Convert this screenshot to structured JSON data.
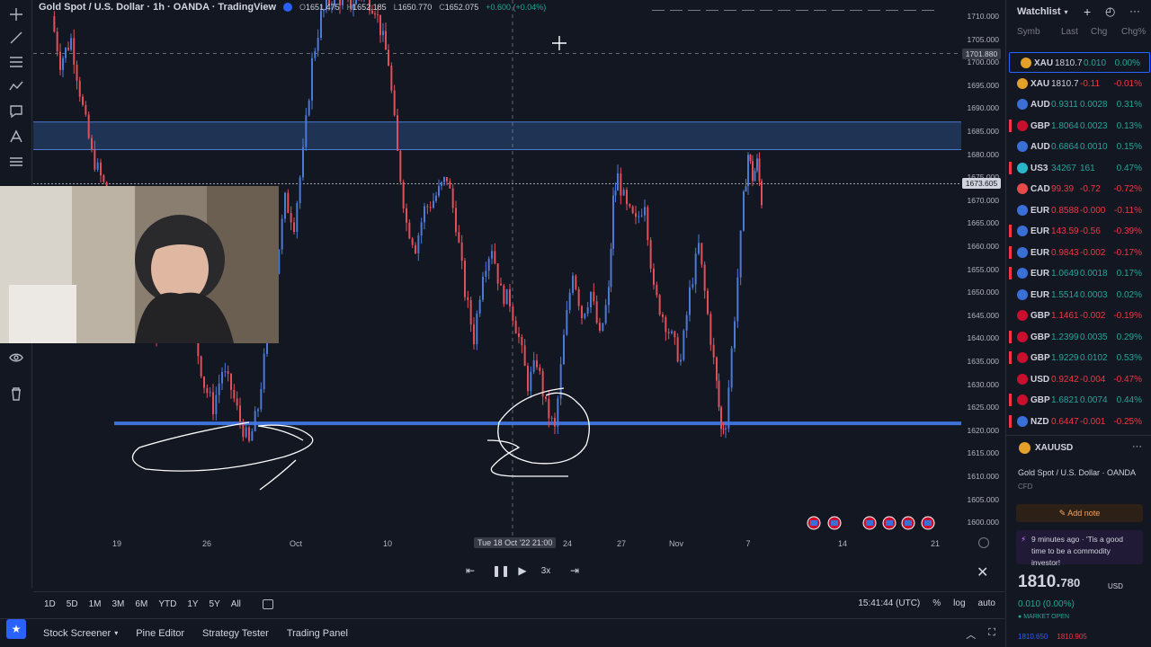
{
  "symbol": {
    "title": "Gold Spot / U.S. Dollar · 1h · OANDA · TradingView",
    "open": "1651.475",
    "high": "1652.185",
    "low": "1650.770",
    "close": "1652.075",
    "change": "+0.600 (+0.04%)"
  },
  "price_axis": {
    "labels": [
      "1710.000",
      "1705.000",
      "1700.000",
      "1695.000",
      "1690.000",
      "1685.000",
      "1680.000",
      "1675.000",
      "1670.000",
      "1665.000",
      "1660.000",
      "1655.000",
      "1650.000",
      "1645.000",
      "1640.000",
      "1635.000",
      "1630.000",
      "1625.000",
      "1620.000",
      "1615.000",
      "1610.000",
      "1605.000",
      "1600.000"
    ],
    "crosshair_price": "1701.880",
    "current_price": "1673.605"
  },
  "time_axis": {
    "labels": [
      "19",
      "26",
      "Oct",
      "10",
      "24",
      "27",
      "Nov",
      "7",
      "14",
      "21"
    ],
    "crosshair_time": "Tue 18 Oct '22  21:00"
  },
  "replay": {
    "speed": "3x",
    "close_icon": "close-icon"
  },
  "range_bar": {
    "ranges": [
      "1D",
      "5D",
      "1M",
      "3M",
      "6M",
      "YTD",
      "1Y",
      "5Y",
      "All"
    ],
    "clock": "15:41:44 (UTC)",
    "percent": "%",
    "log": "log",
    "auto": "auto"
  },
  "bottom_tabs": [
    "Stock Screener",
    "Pine Editor",
    "Strategy Tester",
    "Trading Panel"
  ],
  "watchlist": {
    "title": "Watchlist",
    "columns": [
      "Symb",
      "Last",
      "Chg",
      "Chg%"
    ],
    "rows": [
      {
        "sym": "XAU",
        "last": "1810.7",
        "chg": "0.010",
        "pct": "0.00%",
        "dir": "up",
        "color": "#e3a02a",
        "marker": false,
        "selected": true
      },
      {
        "sym": "XAU",
        "last": "1810.7",
        "chg": "-0.11",
        "pct": "-0.01%",
        "dir": "dn",
        "color": "#e3a02a",
        "marker": false,
        "selected": false
      },
      {
        "sym": "AUD",
        "last": "0.9311",
        "chg": "0.0028",
        "pct": "0.31%",
        "dir": "up",
        "color": "#3b6fd8",
        "marker": false,
        "selected": false
      },
      {
        "sym": "GBP",
        "last": "1.8064",
        "chg": "0.0023",
        "pct": "0.13%",
        "dir": "up",
        "color": "#c8102e",
        "marker": true,
        "selected": false
      },
      {
        "sym": "AUD",
        "last": "0.6864",
        "chg": "0.0010",
        "pct": "0.15%",
        "dir": "up",
        "color": "#3b6fd8",
        "marker": false,
        "selected": false
      },
      {
        "sym": "US3",
        "last": "34267",
        "chg": "161",
        "pct": "0.47%",
        "dir": "up",
        "color": "#2bb5c7",
        "marker": true,
        "selected": false
      },
      {
        "sym": "CAD",
        "last": "99.39",
        "chg": "-0.72",
        "pct": "-0.72%",
        "dir": "dn",
        "color": "#e64a4a",
        "marker": false,
        "selected": false
      },
      {
        "sym": "EUR",
        "last": "0.8588",
        "chg": "-0.000",
        "pct": "-0.11%",
        "dir": "dn",
        "color": "#3b6fd8",
        "marker": false,
        "selected": false
      },
      {
        "sym": "EUR",
        "last": "143.59",
        "chg": "-0.56",
        "pct": "-0.39%",
        "dir": "dn",
        "color": "#3b6fd8",
        "marker": true,
        "selected": false
      },
      {
        "sym": "EUR",
        "last": "0.9843",
        "chg": "-0.002",
        "pct": "-0.17%",
        "dir": "dn",
        "color": "#3b6fd8",
        "marker": true,
        "selected": false
      },
      {
        "sym": "EUR",
        "last": "1.0649",
        "chg": "0.0018",
        "pct": "0.17%",
        "dir": "up",
        "color": "#3b6fd8",
        "marker": true,
        "selected": false
      },
      {
        "sym": "EUR",
        "last": "1.5514",
        "chg": "0.0003",
        "pct": "0.02%",
        "dir": "up",
        "color": "#3b6fd8",
        "marker": false,
        "selected": false
      },
      {
        "sym": "GBP",
        "last": "1.1461",
        "chg": "-0.002",
        "pct": "-0.19%",
        "dir": "dn",
        "color": "#c8102e",
        "marker": false,
        "selected": false
      },
      {
        "sym": "GBP",
        "last": "1.2399",
        "chg": "0.0035",
        "pct": "0.29%",
        "dir": "up",
        "color": "#c8102e",
        "marker": true,
        "selected": false
      },
      {
        "sym": "GBP",
        "last": "1.9229",
        "chg": "0.0102",
        "pct": "0.53%",
        "dir": "up",
        "color": "#c8102e",
        "marker": true,
        "selected": false
      },
      {
        "sym": "USD",
        "last": "0.9242",
        "chg": "-0.004",
        "pct": "-0.47%",
        "dir": "dn",
        "color": "#c8102e",
        "marker": false,
        "selected": false
      },
      {
        "sym": "GBP",
        "last": "1.6821",
        "chg": "0.0074",
        "pct": "0.44%",
        "dir": "up",
        "color": "#c8102e",
        "marker": true,
        "selected": false
      },
      {
        "sym": "NZD",
        "last": "0.6447",
        "chg": "-0.001",
        "pct": "-0.25%",
        "dir": "dn",
        "color": "#3b6fd8",
        "marker": true,
        "selected": false
      }
    ]
  },
  "detail": {
    "symbol": "XAUUSD",
    "name": "Gold Spot / U.S. Dollar · OANDA",
    "type": "CFD",
    "add_note": "Add note",
    "news": "9 minutes ago · 'Tis a good time to be a commodity investor!",
    "price_main": "1810.",
    "price_small": "780",
    "currency": "USD",
    "change": "0.010 (0.00%)",
    "status": "MARKET OPEN",
    "bid": "1810.650",
    "ask": "1810.905"
  },
  "colors": {
    "background": "#131722",
    "up": "#26a69a",
    "down": "#f23645",
    "accent": "#2962ff",
    "zone": "#2a4a80"
  }
}
